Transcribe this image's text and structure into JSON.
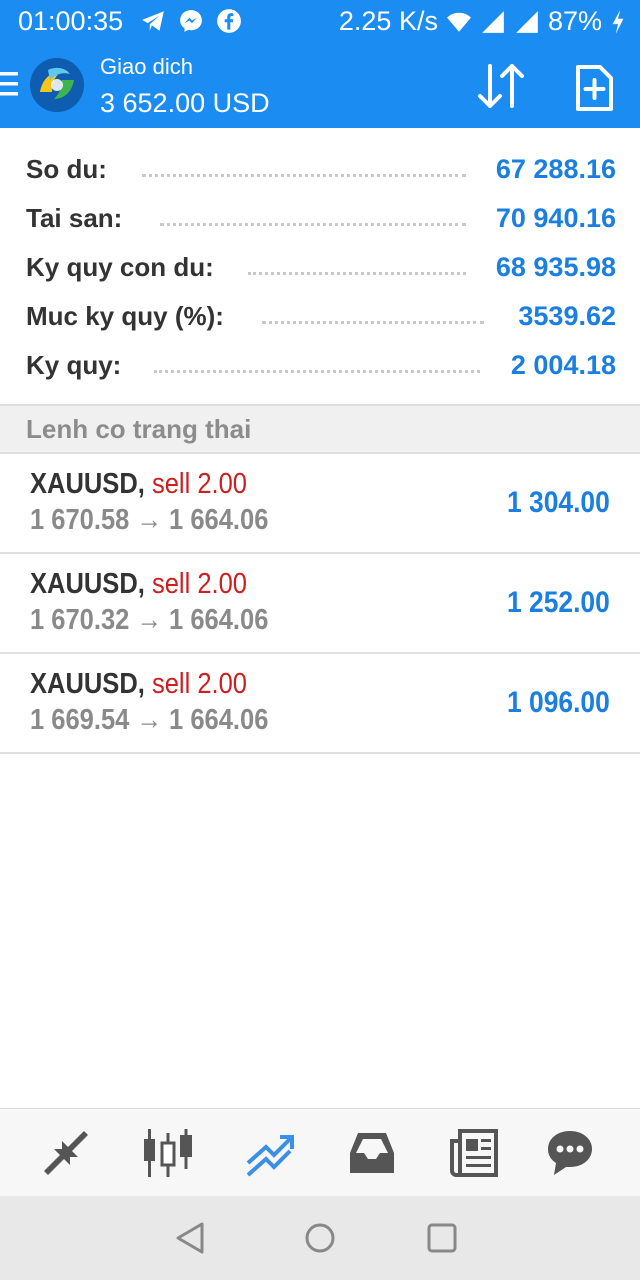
{
  "status_bar": {
    "time": "01:00:35",
    "network_speed": "2.25 K/s",
    "battery": "87%",
    "icons": [
      "telegram-icon",
      "messenger-icon",
      "facebook-icon",
      "wifi-icon",
      "signal-icon",
      "signal-icon",
      "charging-icon"
    ]
  },
  "header": {
    "title": "Giao dich",
    "subtitle": "3 652.00 USD"
  },
  "summary": [
    {
      "label": "So du:",
      "value": "67 288.16"
    },
    {
      "label": "Tai san:",
      "value": "70 940.16"
    },
    {
      "label": "Ky quy con du:",
      "value": "68 935.98"
    },
    {
      "label": "Muc ky quy (%):",
      "value": "3539.62"
    },
    {
      "label": "Ky quy:",
      "value": "2 004.18"
    }
  ],
  "section_title": "Lenh co trang thai",
  "orders": [
    {
      "symbol": "XAUUSD,",
      "side": "sell 2.00",
      "open_price": "1 670.58",
      "arrow": "→",
      "current_price": "1 664.06",
      "profit": "1 304.00"
    },
    {
      "symbol": "XAUUSD,",
      "side": "sell 2.00",
      "open_price": "1 670.32",
      "arrow": "→",
      "current_price": "1 664.06",
      "profit": "1 252.00"
    },
    {
      "symbol": "XAUUSD,",
      "side": "sell 2.00",
      "open_price": "1 669.54",
      "arrow": "→",
      "current_price": "1 664.06",
      "profit": "1 096.00"
    }
  ],
  "bottom_nav": [
    "quotes-icon",
    "chart-icon",
    "trade-icon",
    "history-icon",
    "news-icon",
    "chat-icon"
  ],
  "active_tab": "trade-icon",
  "colors": {
    "accent": "#1a8cf2",
    "value_blue": "#1a7fe0",
    "sell_red": "#cc1f1f",
    "muted": "#8a8a8a"
  }
}
